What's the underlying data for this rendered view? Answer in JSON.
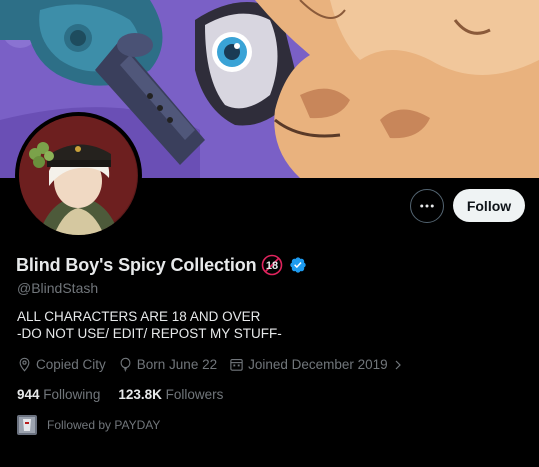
{
  "profile": {
    "display_name": "Blind Boy's Spicy Collection",
    "age_badge_text": "18",
    "handle": "@BlindStash",
    "bio_lines": [
      "ALL CHARACTERS ARE 18 AND OVER",
      "-DO NOT USE/ EDIT/ REPOST MY STUFF-"
    ],
    "location": "Copied City",
    "birthday": "Born June 22",
    "joined": "Joined December 2019"
  },
  "stats": {
    "following_count": "944",
    "following_label": "Following",
    "followers_count": "123.8K",
    "followers_label": "Followers"
  },
  "followed_by": "Followed by PAYDAY",
  "actions": {
    "follow_label": "Follow"
  },
  "icons": {
    "more": "more-horizontal-icon",
    "location": "location-pin-icon",
    "birthday": "balloon-icon",
    "joined": "calendar-icon",
    "verified": "verified-badge-icon"
  },
  "colors": {
    "background": "#000000",
    "verified": "#1d9bf0",
    "muted_text": "#71767b",
    "age_badge": "#e0245e"
  }
}
